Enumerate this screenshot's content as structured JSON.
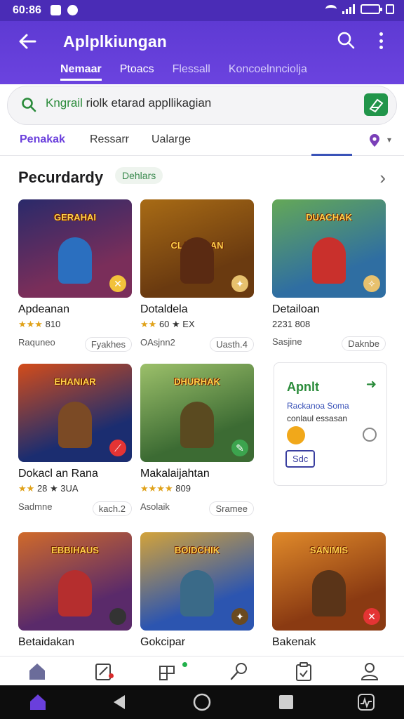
{
  "status": {
    "time": "60:86"
  },
  "header": {
    "title": "Aplplkiungan",
    "tabs": [
      {
        "label": "Nemaar",
        "active": true
      },
      {
        "label": "Ptoacs",
        "active": false
      },
      {
        "label": "Flessall",
        "active": false
      },
      {
        "label": "Koncoelnnciolja",
        "active": false
      }
    ]
  },
  "search": {
    "green_prefix": "Kngrail",
    "query": "riolk etarad  appllikagian"
  },
  "filters": {
    "items": [
      "Penakak",
      "Ressarr",
      "Ualarge"
    ],
    "active": "Penakak"
  },
  "section": {
    "title": "Pecurdardy",
    "chip": "Dehlars"
  },
  "apps": [
    {
      "heading": "GERAHAI",
      "name": "Apdeanan",
      "rating": "★★★",
      "rating_text": "810",
      "foot_left": "Raquneo",
      "foot_right": "Fyakhes",
      "bg": "#7a2e5a",
      "bg2": "#2a2a6a",
      "hero": "#2b6fbf",
      "badge": "#f2c23b",
      "badge_icon": "✕"
    },
    {
      "heading": "CLAISULAN",
      "name": "Dotaldela",
      "rating": "★★",
      "rating_text": "60 ★ EX",
      "foot_left": "OAsjnn2",
      "foot_right": "Uasth.4",
      "bg": "#6a3a10",
      "bg2": "#a86b15",
      "hero": "#5a2a12",
      "badge": "#e7c16e",
      "badge_icon": "✦"
    },
    {
      "heading": "DUACHAK",
      "name": "Detailoan",
      "rating": "",
      "rating_text": "2231 808",
      "foot_left": "Sasjine",
      "foot_right": "Daknbe",
      "bg": "#2f6ea2",
      "bg2": "#64a857",
      "hero": "#c9302c",
      "badge": "#e7c16e",
      "badge_icon": "✧"
    },
    {
      "heading": "EHANIAR",
      "name": "Dokacl an Rana",
      "rating": "★★",
      "rating_text": "28 ★ 3UA",
      "foot_left": "Sadmne",
      "foot_right": "kach.2",
      "bg": "#1b2d70",
      "bg2": "#d34c1a",
      "hero": "#7b4a25",
      "badge": "#e43434",
      "badge_icon": "⟋"
    },
    {
      "heading": "DHURHAK",
      "name": "Makalaijahtan",
      "rating": "★★★★",
      "rating_text": "809",
      "foot_left": "Asolaik",
      "foot_right": "Sramee",
      "bg": "#3c6b33",
      "bg2": "#9cc06a",
      "hero": "#5a4a20",
      "badge": "#3ca44e",
      "badge_icon": "✎"
    },
    {
      "heading": "EBBIHAUS",
      "name": "Betaidakan",
      "rating": "",
      "rating_text": "",
      "foot_left": "",
      "foot_right": "",
      "bg": "#5a2a6a",
      "bg2": "#d06a2a",
      "hero": "#b52e2e",
      "badge": "#333333",
      "badge_icon": ""
    },
    {
      "heading": "BOIDCHIK",
      "name": "Gokcipar",
      "rating": "",
      "rating_text": "",
      "foot_left": "",
      "foot_right": "",
      "bg": "#2c55b0",
      "bg2": "#d3a33a",
      "hero": "#3a6a88",
      "badge": "#6a4a20",
      "badge_icon": "✦"
    },
    {
      "heading": "SANIMIS",
      "name": "Bakenak",
      "rating": "",
      "rating_text": "",
      "foot_left": "",
      "foot_right": "",
      "bg": "#8a3a12",
      "bg2": "#e08a2a",
      "hero": "#5a3418",
      "badge": "#e43434",
      "badge_icon": "✕"
    }
  ],
  "promo": {
    "title": "Apnlt",
    "sub": "Rackanoa Soma",
    "desc": "conlaul essasan",
    "button": "Sdc"
  }
}
